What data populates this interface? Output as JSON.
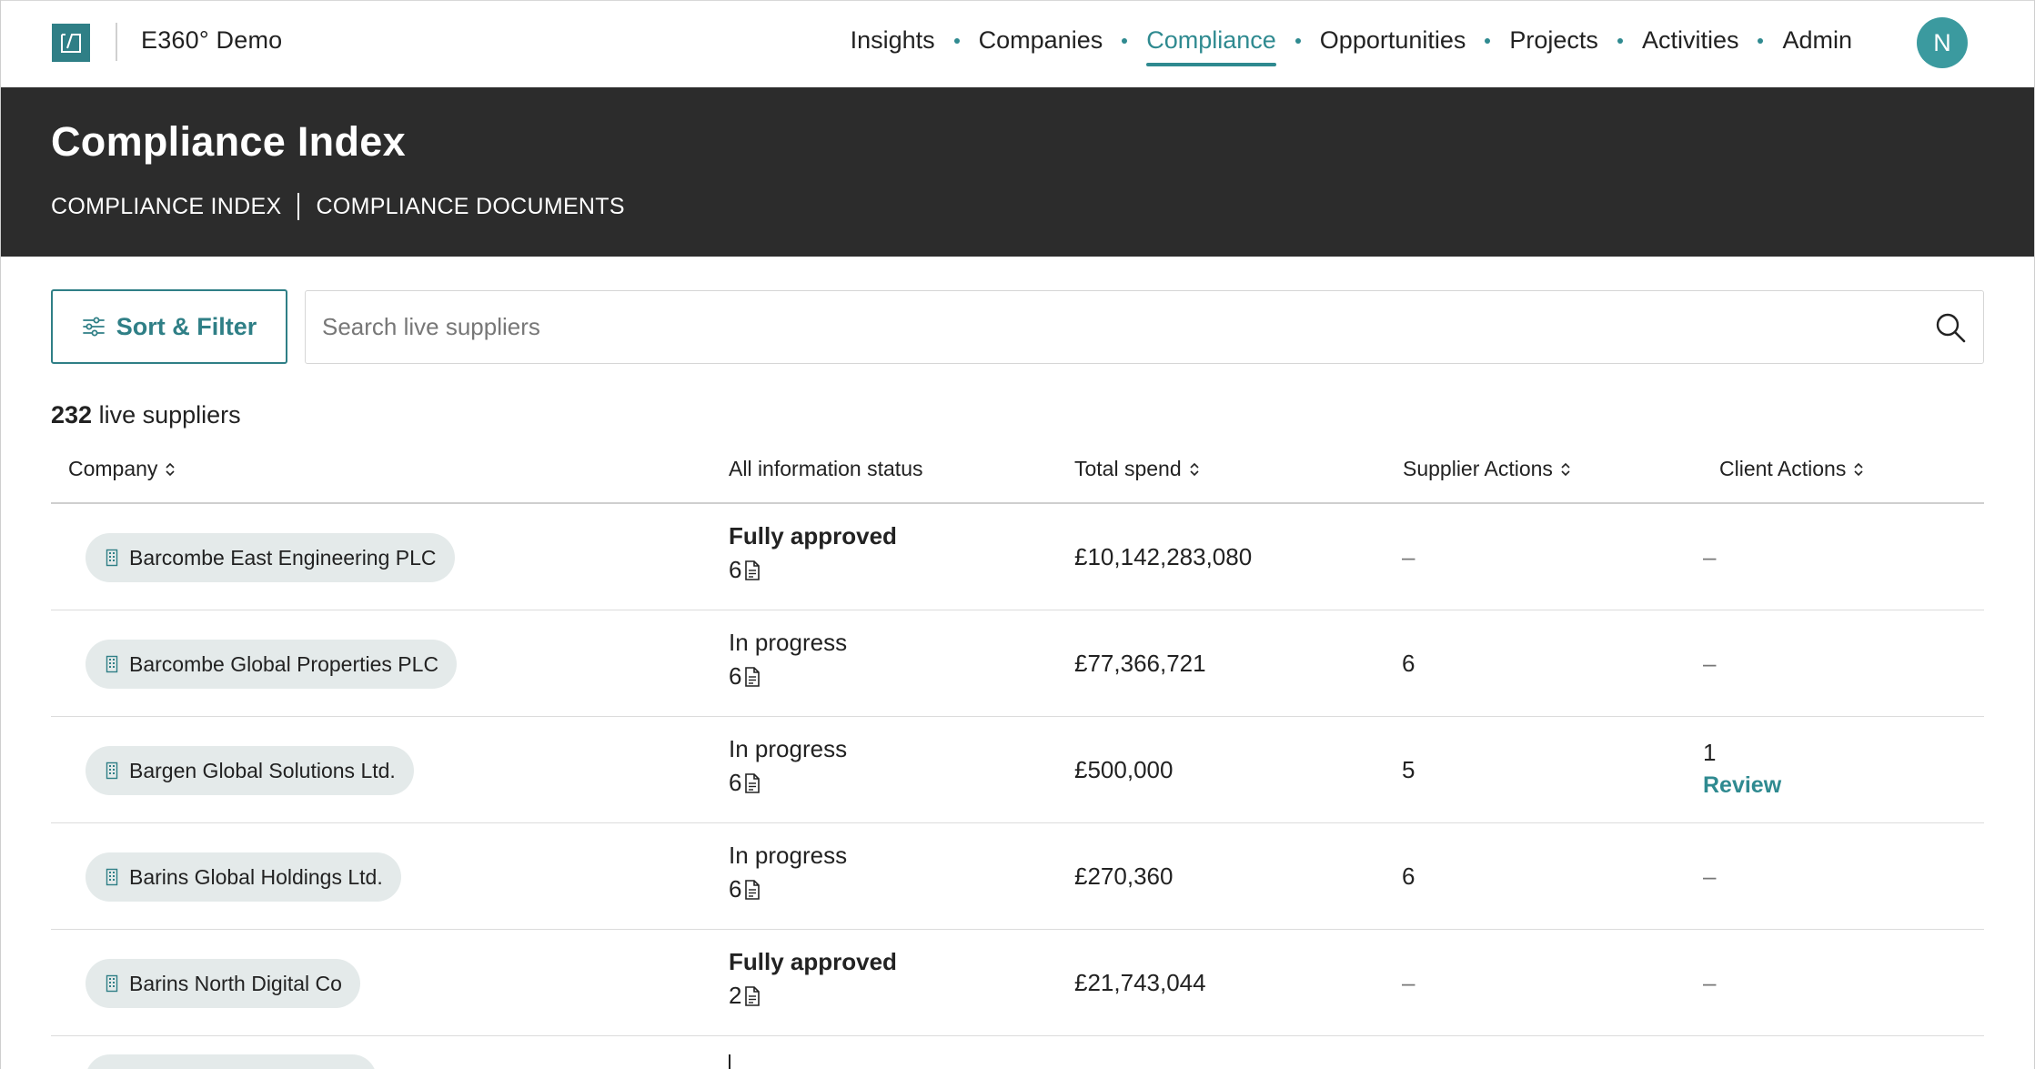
{
  "app": {
    "name": "E360° Demo"
  },
  "nav": {
    "items": [
      {
        "label": "Insights",
        "active": false
      },
      {
        "label": "Companies",
        "active": false
      },
      {
        "label": "Compliance",
        "active": true
      },
      {
        "label": "Opportunities",
        "active": false
      },
      {
        "label": "Projects",
        "active": false
      },
      {
        "label": "Activities",
        "active": false
      },
      {
        "label": "Admin",
        "active": false
      }
    ],
    "avatar_initial": "N"
  },
  "header": {
    "title": "Compliance Index",
    "subnav": [
      "COMPLIANCE INDEX",
      "COMPLIANCE DOCUMENTS"
    ]
  },
  "toolbar": {
    "sort_filter_label": "Sort & Filter",
    "search_placeholder": "Search live suppliers",
    "search_value": ""
  },
  "summary": {
    "count": "232",
    "label": "live suppliers"
  },
  "table": {
    "columns": [
      "Company",
      "All information status",
      "Total spend",
      "Supplier Actions",
      "Client Actions"
    ],
    "rows": [
      {
        "company": "Barcombe East Engineering PLC",
        "status": "Fully approved",
        "docs": "6",
        "spend": "£10,142,283,080",
        "supplier_actions": "–",
        "client_actions": "–",
        "client_action_link": ""
      },
      {
        "company": "Barcombe Global Properties PLC",
        "status": "In progress",
        "docs": "6",
        "spend": "£77,366,721",
        "supplier_actions": "6",
        "client_actions": "–",
        "client_action_link": ""
      },
      {
        "company": "Bargen Global Solutions Ltd.",
        "status": "In progress",
        "docs": "6",
        "spend": "£500,000",
        "supplier_actions": "5",
        "client_actions": "1",
        "client_action_link": "Review"
      },
      {
        "company": "Barins Global Holdings Ltd.",
        "status": "In progress",
        "docs": "6",
        "spend": "£270,360",
        "supplier_actions": "6",
        "client_actions": "–",
        "client_action_link": ""
      },
      {
        "company": "Barins North Digital Co",
        "status": "Fully approved",
        "docs": "2",
        "spend": "£21,743,044",
        "supplier_actions": "–",
        "client_actions": "–",
        "client_action_link": ""
      }
    ]
  },
  "colors": {
    "accent": "#2f8a90",
    "header_band": "#2c2c2c",
    "pill_bg": "#e4eaea",
    "avatar": "#3b9a9f"
  },
  "icons": {
    "logo": "brand-logo-icon",
    "filter": "sliders-icon",
    "search": "search-icon",
    "sort": "sort-arrows-icon",
    "company": "building-icon",
    "document": "document-icon"
  }
}
